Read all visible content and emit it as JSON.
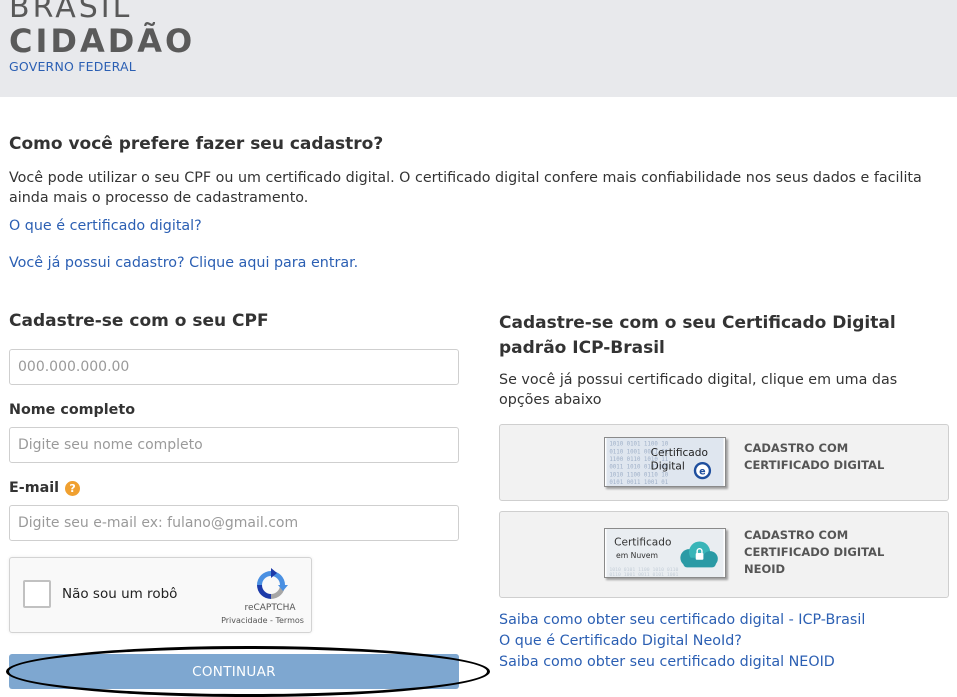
{
  "header": {
    "logo_line1": "BRASIL",
    "logo_line2": "CIDADÃO",
    "logo_line3": "GOVERNO FEDERAL"
  },
  "intro": {
    "question": "Como você prefere fazer seu cadastro?",
    "text": "Você pode utilizar o seu CPF ou um certificado digital. O certificado digital confere mais confiabilidade nos seus dados e facilita ainda mais o processo de cadastramento.",
    "what_is_cert_link": "O que é certificado digital?",
    "login_link": "Você já possui cadastro? Clique aqui para entrar."
  },
  "cpf_form": {
    "title": "Cadastre-se com o seu CPF",
    "cpf_placeholder": "000.000.000.00",
    "name_label": "Nome completo",
    "name_placeholder": "Digite seu nome completo",
    "email_label": "E-mail",
    "email_help_icon": "question-circle-icon",
    "email_placeholder": "Digite seu e-mail ex: fulano@gmail.com",
    "captcha": {
      "label": "Não sou um robô",
      "brand": "reCAPTCHA",
      "privacy": "Privacidade",
      "separator": " - ",
      "terms": "Termos"
    },
    "continue_label": "CONTINUAR"
  },
  "cert_form": {
    "title": "Cadastre-se com o seu Certificado Digital padrão ICP-Brasil",
    "subtitle": "Se você já possui certificado digital, clique em uma das opções abaixo",
    "options": [
      {
        "img_line1": "Certificado",
        "img_line2": "Digital",
        "img_badge": "e",
        "label_line1": "CADASTRO COM",
        "label_line2": "CERTIFICADO DIGITAL"
      },
      {
        "img_line1": "Certificado",
        "img_line2": "em Nuvem",
        "label_line1": "CADASTRO COM",
        "label_line2": "CERTIFICADO DIGITAL",
        "label_line3": "NEOID"
      }
    ],
    "links": [
      "Saiba como obter seu certificado digital - ICP-Brasil",
      "O que é Certificado Digital NeoId?",
      "Saiba como obter seu certificado digital NEOID"
    ]
  },
  "colors": {
    "link": "#2b5fb3",
    "header_bg": "#e8e9ec",
    "continue_bg": "#7ea7d0",
    "help_icon": "#f0a030",
    "annotation_ellipse": "#000000"
  }
}
